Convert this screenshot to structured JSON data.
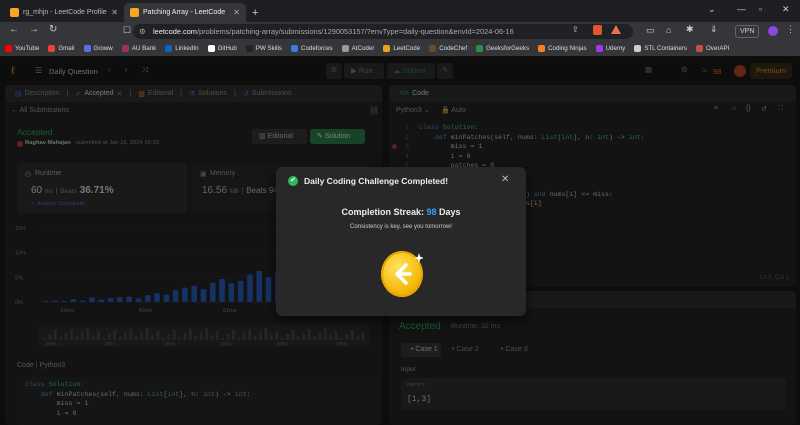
{
  "browser": {
    "tabs": [
      {
        "label": "rg_mhjn - LeetCode Profile",
        "active": false
      },
      {
        "label": "Patching Array - LeetCode",
        "active": true
      }
    ],
    "new_tab": "+",
    "url_host": "leetcode.com",
    "url_path": "/problems/patching-array/submissions/1290053157/?envType=daily-question&envId=2024-06-16",
    "vpn": "VPN",
    "bookmarks": [
      "YouTube",
      "Gmail",
      "Groww",
      "AU Bank",
      "LinkedIn",
      "GitHub",
      "PW Skills",
      "Codeforces",
      "AtCoder",
      "LeetCode",
      "CodeChef",
      "GeeksforGeeks",
      "Coding Ninjas",
      "Udemy",
      "STL Containers",
      "OverAPI"
    ],
    "bookmark_colors": [
      "#ff0000",
      "#ea4335",
      "#5b6ee1",
      "#a1305c",
      "#0a66c2",
      "#ffffff",
      "#222222",
      "#3b7dd8",
      "#999999",
      "#f0a020",
      "#6b4a2a",
      "#2f8d46",
      "#f58220",
      "#a435f0",
      "#cccccc",
      "#c0504d"
    ]
  },
  "lc_nav": {
    "problem_list": "Daily Question",
    "run": "Run",
    "submit": "Submit",
    "streak": "98",
    "premium": "Premium"
  },
  "left": {
    "tabs": [
      "Description",
      "Accepted",
      "Editorial",
      "Solutions",
      "Submissions"
    ],
    "back": "All Submissions",
    "status": "Accepted",
    "author": "Raghav Mahajan",
    "submitted": "submitted at Jun 16, 2024 16:33",
    "editorial_btn": "Editorial",
    "solution_btn": "Solution",
    "runtime_label": "Runtime",
    "runtime_value": "60",
    "runtime_unit": "ms",
    "beats_label": "Beats",
    "beats_value": "36.71%",
    "analyze": "Analyze Complexity",
    "memory_label": "Memory",
    "memory_value": "16.56",
    "memory_unit": "MB",
    "memory_beats": "Beats 94",
    "yaxis": [
      "15%",
      "10%",
      "5%",
      "0%"
    ],
    "xticks": [
      "29ms",
      "40ms",
      "51ms",
      "56ms"
    ],
    "mini_xticks": [
      "29ms",
      "39ms",
      "49ms",
      "59ms",
      "69ms",
      "78ms",
      "88ms"
    ],
    "code_header": "Code",
    "code_lang": "Python3",
    "code_lines": [
      "class Solution:",
      "    def minPatches(self, nums: List[int], n: int) -> int:",
      "        miss = 1",
      "        i = 0"
    ]
  },
  "chart_data": {
    "type": "bar",
    "title": "",
    "ylabel": "",
    "xlabel": "",
    "ylim": [
      0,
      15
    ],
    "x_tick_labels": [
      "29ms",
      "40ms",
      "51ms",
      "56ms"
    ],
    "values": [
      0.2,
      0.3,
      0.2,
      0.6,
      0.3,
      0.9,
      0.5,
      0.8,
      1.0,
      1.1,
      0.7,
      1.4,
      1.8,
      1.5,
      2.4,
      2.9,
      3.3,
      2.6,
      3.9,
      4.7,
      3.8,
      4.3,
      5.6,
      6.3,
      5.0,
      5.9,
      7.8,
      6.6,
      9.5,
      7.7,
      8.9,
      10.7,
      8.4,
      6.3,
      9.4
    ],
    "highlight_index": 34
  },
  "right": {
    "tab": "Code",
    "lang": "Python3",
    "auto": "Auto",
    "code_lines": [
      "class Solution:",
      "    def minPatches(self, nums: List[int], n: int) -> int:",
      "        miss = 1",
      "        i = 0",
      "        patches = 0",
      "",
      "        while miss <= n:",
      "            if i < len(nums) and nums[i] <= miss:",
      "                miss += nums[i]",
      "                i += 1"
    ],
    "line_numbers": [
      "1",
      "2",
      "3",
      "4",
      "5",
      "6",
      "7",
      "8",
      "9",
      "10"
    ],
    "cursor": "Ln 1, Col 1",
    "result_status": "Accepted",
    "result_runtime": "Runtime: 32 ms",
    "cases": [
      "Case 1",
      "Case 2",
      "Case 3"
    ],
    "input_label": "Input",
    "input_var": "nums =",
    "input_value": "[1,3]"
  },
  "modal": {
    "title": "Daily Coding Challenge Completed!",
    "streak_label": "Completion Streak:",
    "streak_value": "98",
    "streak_unit": "Days",
    "message": "Consistency is key, see you tomorrow!"
  }
}
